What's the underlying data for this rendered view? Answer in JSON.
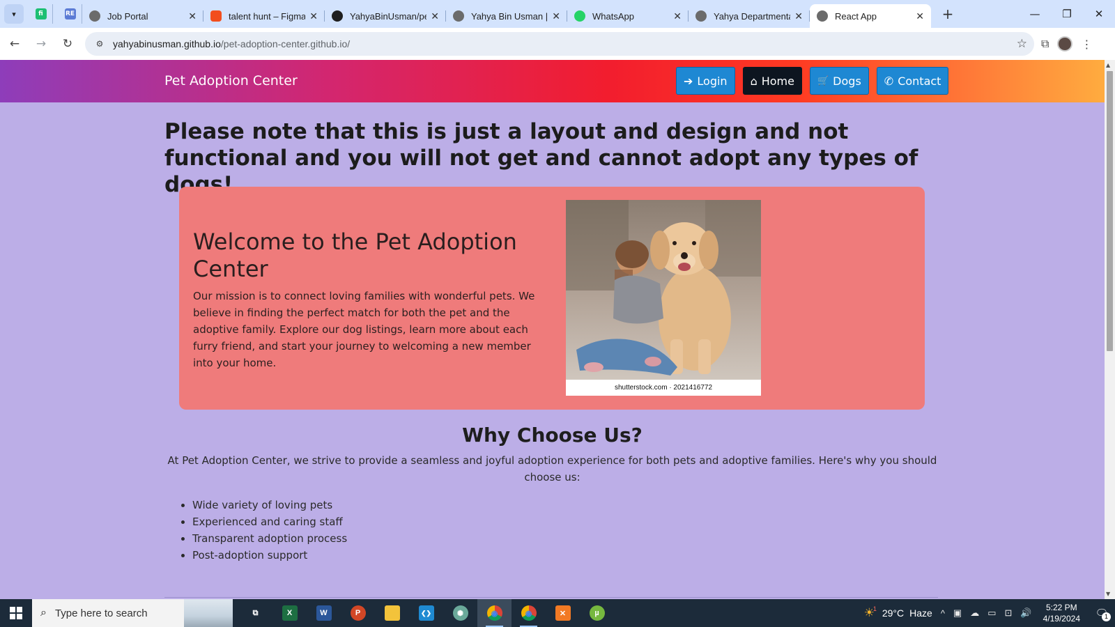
{
  "browser": {
    "pinned_tabs": [
      {
        "icon": "fiverr-icon",
        "letter": "fi",
        "color": "#1dbf73"
      },
      {
        "icon": "repo-icon",
        "letter": "RE",
        "color": "#5b7bd5"
      }
    ],
    "tabs": [
      {
        "title": "Job Portal",
        "icon": "globe-icon",
        "color": "#6b6b6b"
      },
      {
        "title": "talent hunt – Figma",
        "icon": "figma-icon",
        "color": "#f24e1e"
      },
      {
        "title": "YahyaBinUsman/pe",
        "icon": "github-icon",
        "color": "#1f1f1f"
      },
      {
        "title": "Yahya Bin Usman | F",
        "icon": "globe-icon",
        "color": "#6b6b6b"
      },
      {
        "title": "WhatsApp",
        "icon": "whatsapp-icon",
        "color": "#25d366"
      },
      {
        "title": "Yahya Departmenta",
        "icon": "globe-icon",
        "color": "#6b6b6b"
      },
      {
        "title": "React App",
        "icon": "globe-icon",
        "color": "#6b6b6b",
        "active": true
      }
    ],
    "url_host": "yahyabinusman.github.io",
    "url_path": "/pet-adoption-center.github.io/"
  },
  "navbar": {
    "brand": "Pet Adoption Center",
    "buttons": [
      {
        "label": "Login",
        "icon": "sign-in-icon",
        "glyph": "➔"
      },
      {
        "label": "Home",
        "icon": "home-icon",
        "glyph": "⌂"
      },
      {
        "label": "Dogs",
        "icon": "cart-icon",
        "glyph": "🛒"
      },
      {
        "label": "Contact",
        "icon": "phone-icon",
        "glyph": "✆"
      }
    ]
  },
  "page": {
    "notice": "Please note that this is just a layout and design and not functional and you will not get and cannot adopt any types of dogs!.",
    "hero": {
      "title": "Welcome to the Pet Adoption Center",
      "text": "Our mission is to connect loving families with wonderful pets. We believe in finding the perfect match for both the pet and the adoptive family. Explore our dog listings, learn more about each furry friend, and start your journey to welcoming a new member into your home.",
      "image_credit": "shutterstock.com · 2021416772"
    },
    "why": {
      "title": "Why Choose Us?",
      "text": "At Pet Adoption Center, we strive to provide a seamless and joyful adoption experience for both pets and adoptive families. Here's why you should choose us:",
      "items": [
        "Wide variety of loving pets",
        "Experienced and caring staff",
        "Transparent adoption process",
        "Post-adoption support"
      ]
    }
  },
  "taskbar": {
    "search_placeholder": "Type here to search",
    "apps": [
      {
        "icon": "task-view-icon",
        "label": "⧉",
        "color": "transparent"
      },
      {
        "icon": "excel-icon",
        "label": "X",
        "color": "#1d6f42"
      },
      {
        "icon": "word-icon",
        "label": "W",
        "color": "#2b579a"
      },
      {
        "icon": "powerpoint-icon",
        "label": "P",
        "color": "#d24726"
      },
      {
        "icon": "file-explorer-icon",
        "label": "▬",
        "color": "#f3c33b"
      },
      {
        "icon": "vscode-icon",
        "label": "❮❯",
        "color": "#1f8ad2"
      },
      {
        "icon": "chatgpt-icon",
        "label": "✺",
        "color": "#6aa99a"
      },
      {
        "icon": "chrome-icon",
        "label": "◉",
        "color": "#e33b2e",
        "active": true
      },
      {
        "icon": "chrome-profile-icon",
        "label": "◉",
        "color": "#e33b2e"
      },
      {
        "icon": "xampp-icon",
        "label": "✕",
        "color": "#f27a24"
      },
      {
        "icon": "utorrent-icon",
        "label": "µ",
        "color": "#76b83f"
      }
    ],
    "weather": {
      "temp": "29°C",
      "condition": "Haze",
      "badge": "1"
    },
    "time": "5:22 PM",
    "date": "4/19/2024",
    "notifications": "1"
  }
}
